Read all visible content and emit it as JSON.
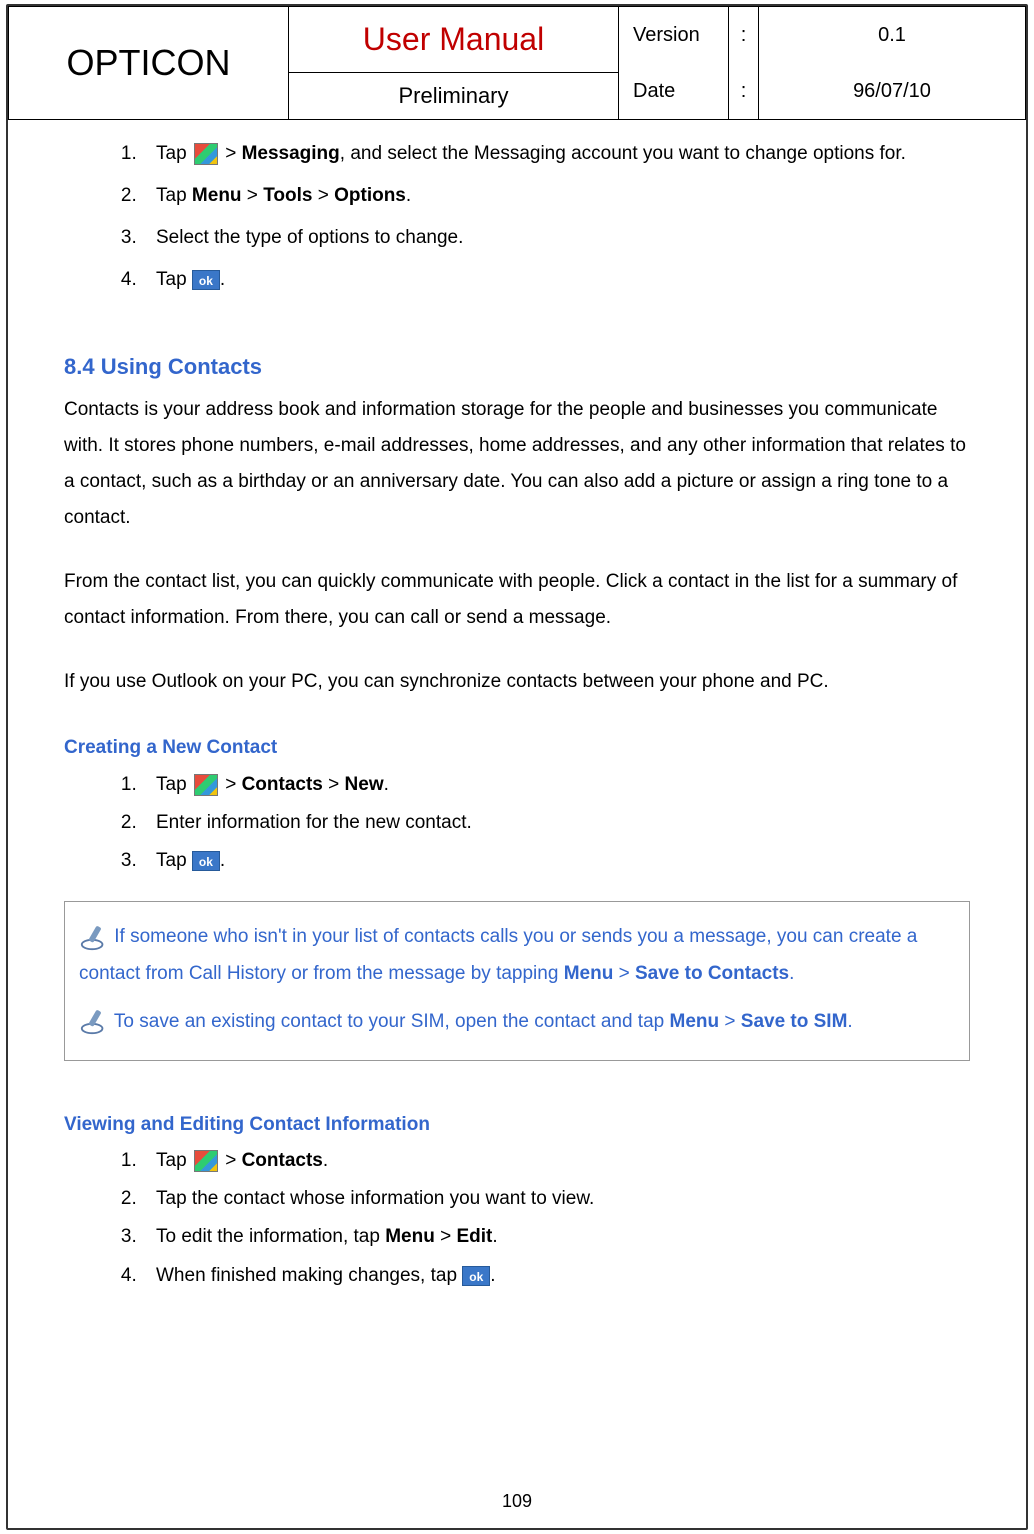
{
  "header": {
    "brand": "OPTICON",
    "title": "User Manual",
    "subtitle": "Preliminary",
    "version_label": "Version",
    "version_value": "0.1",
    "date_label": "Date",
    "date_value": "96/07/10",
    "colon": ":"
  },
  "listA": {
    "i1a": "Tap ",
    "i1b": " > ",
    "i1c": "Messaging",
    "i1d": ", and select the Messaging account you want to change options for.",
    "i2a": "Tap ",
    "i2b": "Menu",
    "i2c": " > ",
    "i2d": "Tools",
    "i2e": " > ",
    "i2f": "Options",
    "i2g": ".",
    "i3": "Select the type of options to change.",
    "i4a": "Tap ",
    "i4b": "."
  },
  "section_head": "8.4 Using Contacts",
  "para1": "Contacts is your address book and information storage for the people and businesses you communicate with. It stores phone numbers, e-mail addresses, home addresses, and any other information that relates to a contact, such as a birthday or an anniversary date. You can also add a picture or assign a ring tone to a contact.",
  "para2": "From the contact list, you can quickly communicate with people. Click a contact in the list for a summary of contact information. From there, you can call or send a message.",
  "para3": "If you use Outlook on your PC, you can synchronize contacts between your phone and PC.",
  "sub1": "Creating a New Contact",
  "listB": {
    "i1a": "Tap ",
    "i1b": " > ",
    "i1c": "Contacts",
    "i1d": " > ",
    "i1e": "New",
    "i1f": ".",
    "i2": "Enter information for the new contact.",
    "i3a": "Tap ",
    "i3b": "."
  },
  "tip1a": "  If someone who isn't in your list of contacts calls you or sends you a message, you can create a contact from Call History or from the message by tapping ",
  "tip1b": "Menu",
  "tip1c": " > ",
  "tip1d": "Save to Contacts",
  "tip1e": ".",
  "tip2a": "  To save an existing contact to your SIM, open the contact and tap ",
  "tip2b": "Menu",
  "tip2c": " > ",
  "tip2d": "Save to SIM",
  "tip2e": ".",
  "sub2": "Viewing and Editing Contact Information",
  "listC": {
    "i1a": "Tap ",
    "i1b": " > ",
    "i1c": "Contacts",
    "i1d": ".",
    "i2": "Tap the contact whose information you want to view.",
    "i3a": "To edit the information, tap ",
    "i3b": "Menu",
    "i3c": " > ",
    "i3d": "Edit",
    "i3e": ".",
    "i4a": "When finished making changes, tap ",
    "i4b": "."
  },
  "ok_text": "ok",
  "page_number": "109"
}
